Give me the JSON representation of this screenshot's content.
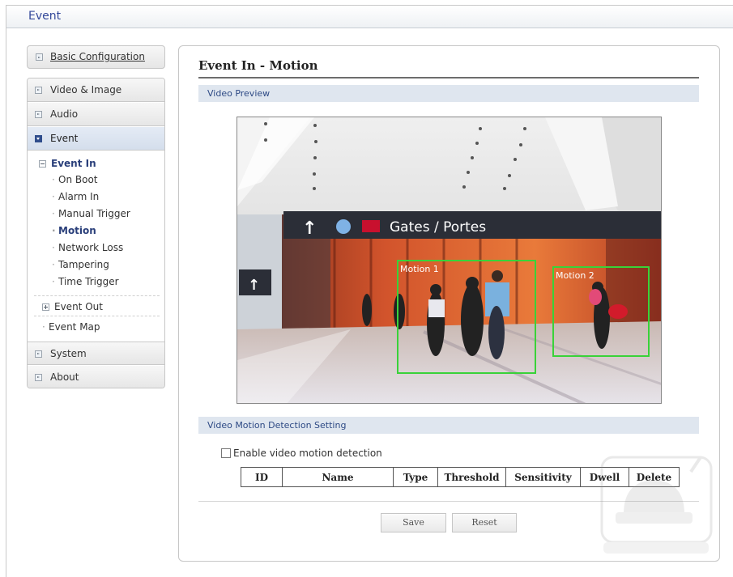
{
  "window": {
    "title": "Event"
  },
  "sidebar": {
    "basic_config": "Basic Configuration",
    "items": [
      {
        "label": "Video & Image"
      },
      {
        "label": "Audio"
      },
      {
        "label": "Event"
      },
      {
        "label": "System"
      },
      {
        "label": "About"
      }
    ],
    "event_in": {
      "label": "Event In",
      "subitems": [
        "On Boot",
        "Alarm In",
        "Manual Trigger",
        "Motion",
        "Network Loss",
        "Tampering",
        "Time Trigger"
      ],
      "selected": "Motion"
    },
    "event_out": "Event Out",
    "event_map": "Event Map"
  },
  "main": {
    "title": "Event In - Motion",
    "video_preview": {
      "section_label": "Video Preview",
      "sign_text": "Gates / Portes",
      "zones": [
        "Motion 1",
        "Motion 2"
      ]
    },
    "settings": {
      "section_label": "Video Motion Detection Setting",
      "enable_label": "Enable video motion detection",
      "enable_checked": false,
      "columns": [
        "ID",
        "Name",
        "Type",
        "Threshold",
        "Sensitivity",
        "Dwell",
        "Delete"
      ]
    },
    "buttons": {
      "save": "Save",
      "reset": "Reset"
    }
  },
  "colors": {
    "accent": "#2e4a85",
    "section_bg": "#dfe6ef",
    "motion_zone": "#39d239"
  }
}
